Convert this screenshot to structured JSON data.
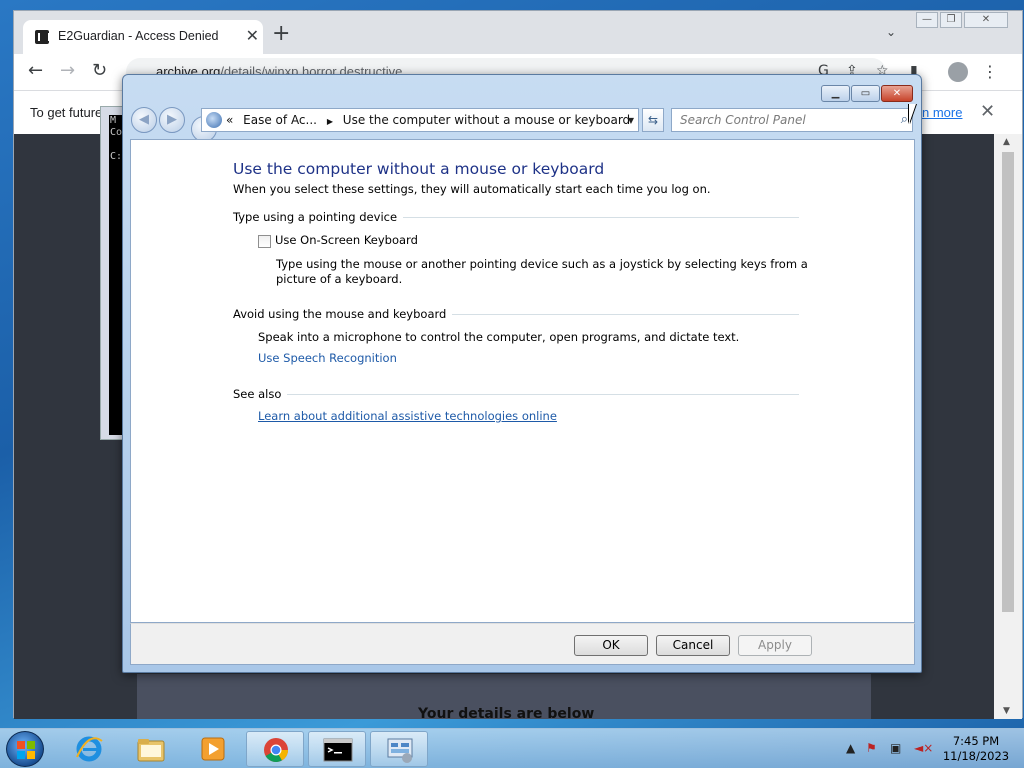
{
  "browser": {
    "tab_title": "E2Guardian - Access Denied",
    "url_main": "archive.org",
    "url_path": "/details/winxp.horror.destructive",
    "infobar_message": "To get future",
    "infobar_link": "n more",
    "page_footer_text": "Your details are below"
  },
  "console": {
    "lines": "M\nCo\n\nC:"
  },
  "control_panel": {
    "breadcrumb": {
      "prefix": "«",
      "parent": "Ease of Ac...",
      "current": "Use the computer without a mouse or keyboard"
    },
    "search_placeholder": "Search Control Panel",
    "heading": "Use the computer without a mouse or keyboard",
    "subheading": "When you select these settings, they will automatically start each time you log on.",
    "sections": {
      "pointing": {
        "title": "Type using a pointing device",
        "checkbox_label": "Use On-Screen Keyboard",
        "checkbox_checked": false,
        "description": "Type using the mouse or another pointing device such as a joystick by selecting keys from a picture of a keyboard."
      },
      "avoid": {
        "title": "Avoid using the mouse and keyboard",
        "description": "Speak into a microphone to control the computer, open programs, and dictate text.",
        "link": "Use Speech Recognition"
      },
      "see_also": {
        "title": "See also",
        "link": "Learn about additional assistive technologies online"
      }
    },
    "buttons": {
      "ok": "OK",
      "cancel": "Cancel",
      "apply": "Apply"
    }
  },
  "taskbar": {
    "time": "7:45 PM",
    "date": "11/18/2023"
  },
  "colors": {
    "heading": "#1e3287",
    "link": "#1e5aa8",
    "close_red": "#c7432a"
  }
}
